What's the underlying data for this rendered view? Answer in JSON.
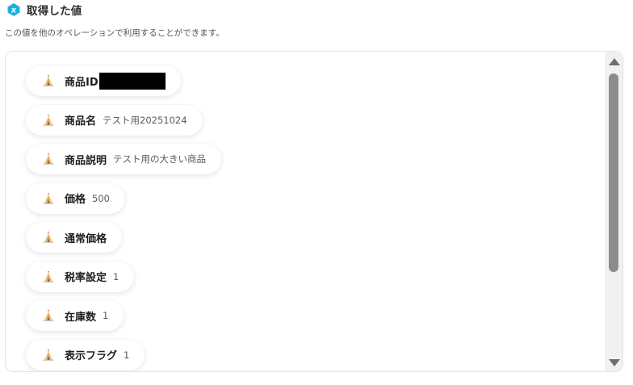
{
  "header": {
    "title": "取得した値",
    "subtitle": "この値を他のオペレーションで利用することができます。",
    "icon": "variable-x-icon",
    "accent_color": "#1ab3e0"
  },
  "fields": [
    {
      "label": "商品ID",
      "value": "",
      "redacted": true
    },
    {
      "label": "商品名",
      "value": "テスト用20251024"
    },
    {
      "label": "商品説明",
      "value": "テスト用の大きい商品"
    },
    {
      "label": "価格",
      "value": "500"
    },
    {
      "label": "通常価格",
      "value": ""
    },
    {
      "label": "税率設定",
      "value": "1"
    },
    {
      "label": "在庫数",
      "value": "1"
    },
    {
      "label": "表示フラグ",
      "value": "1"
    }
  ],
  "field_icon": "tent-icon"
}
